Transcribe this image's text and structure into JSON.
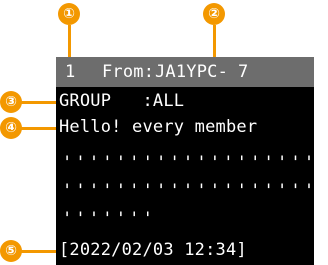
{
  "callouts": {
    "c1": "①",
    "c2": "②",
    "c3": "③",
    "c4": "④",
    "c5": "⑤"
  },
  "header": {
    "index": "1",
    "from_label": "From:",
    "callsign": "JA1YPC-",
    "ssid": "7"
  },
  "message": {
    "group_line": "GROUP   :ALL",
    "text_line": "Hello! every member",
    "filler_row_1": "''''''''''''''''''''",
    "filler_row_2": "''''''''''''''''''''",
    "filler_row_3": "'''''''",
    "timestamp": "[2022/02/03 12:34]"
  },
  "colors": {
    "callout": "#f39800",
    "screen_bg": "#000000",
    "header_bg": "#6d6d6d",
    "text": "#ffffff"
  }
}
